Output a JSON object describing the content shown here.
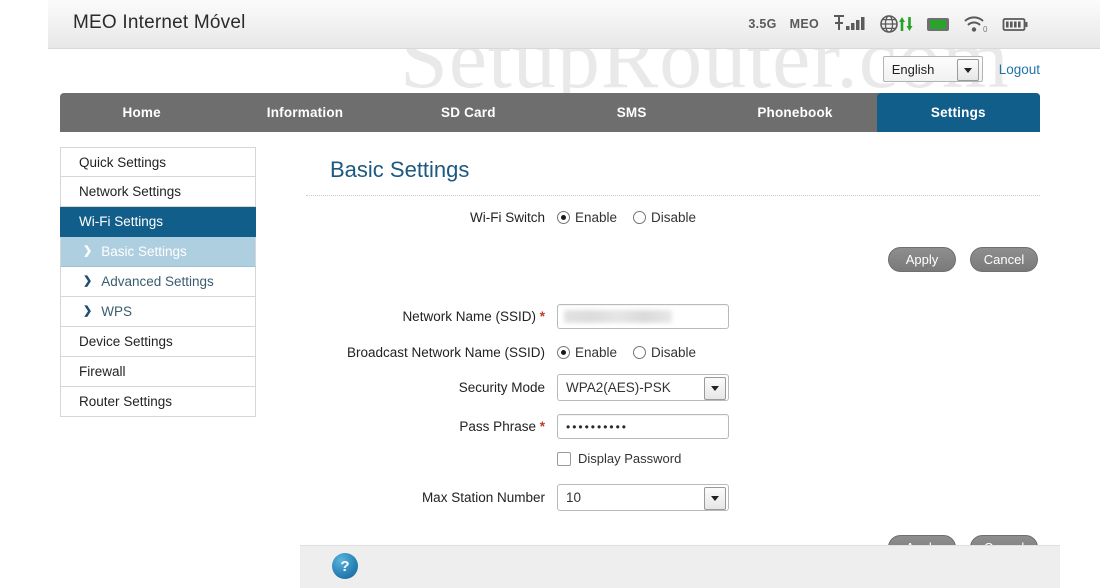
{
  "watermark": "SetupRouter.com",
  "header": {
    "brand": "MEO Internet Móvel",
    "status": {
      "network_type": "3.5G",
      "carrier": "MEO",
      "signal_icon": "signal-bars-icon",
      "globe_icon": "globe-data-transfer-icon",
      "sim_icon": "sim-card-icon",
      "wifi_icon": "wifi-icon",
      "wifi_clients": "0",
      "battery_icon": "battery-icon"
    }
  },
  "topbar": {
    "language": "English",
    "logout": "Logout"
  },
  "nav": {
    "tabs": [
      {
        "label": "Home",
        "active": false
      },
      {
        "label": "Information",
        "active": false
      },
      {
        "label": "SD Card",
        "active": false
      },
      {
        "label": "SMS",
        "active": false
      },
      {
        "label": "Phonebook",
        "active": false
      },
      {
        "label": "Settings",
        "active": true
      }
    ]
  },
  "sidebar": {
    "items": [
      {
        "label": "Quick Settings"
      },
      {
        "label": "Network Settings"
      },
      {
        "label": "Wi-Fi Settings"
      },
      {
        "label": "Basic Settings"
      },
      {
        "label": "Advanced Settings"
      },
      {
        "label": "WPS"
      },
      {
        "label": "Device Settings"
      },
      {
        "label": "Firewall"
      },
      {
        "label": "Router Settings"
      }
    ]
  },
  "main": {
    "title": "Basic Settings",
    "wifi_switch": {
      "label": "Wi-Fi Switch",
      "enable": "Enable",
      "disable": "Disable",
      "value": "Enable"
    },
    "apply": "Apply",
    "cancel": "Cancel",
    "ssid": {
      "label": "Network Name (SSID)",
      "required": "*",
      "value": ""
    },
    "broadcast": {
      "label": "Broadcast Network Name (SSID)",
      "enable": "Enable",
      "disable": "Disable",
      "value": "Enable"
    },
    "security_mode": {
      "label": "Security Mode",
      "value": "WPA2(AES)-PSK"
    },
    "pass_phrase": {
      "label": "Pass Phrase",
      "required": "*",
      "value": "••••••••••"
    },
    "display_password": {
      "label": "Display Password",
      "checked": false
    },
    "max_station": {
      "label": "Max Station Number",
      "value": "10"
    }
  },
  "footer": {
    "help_label": "?"
  }
}
